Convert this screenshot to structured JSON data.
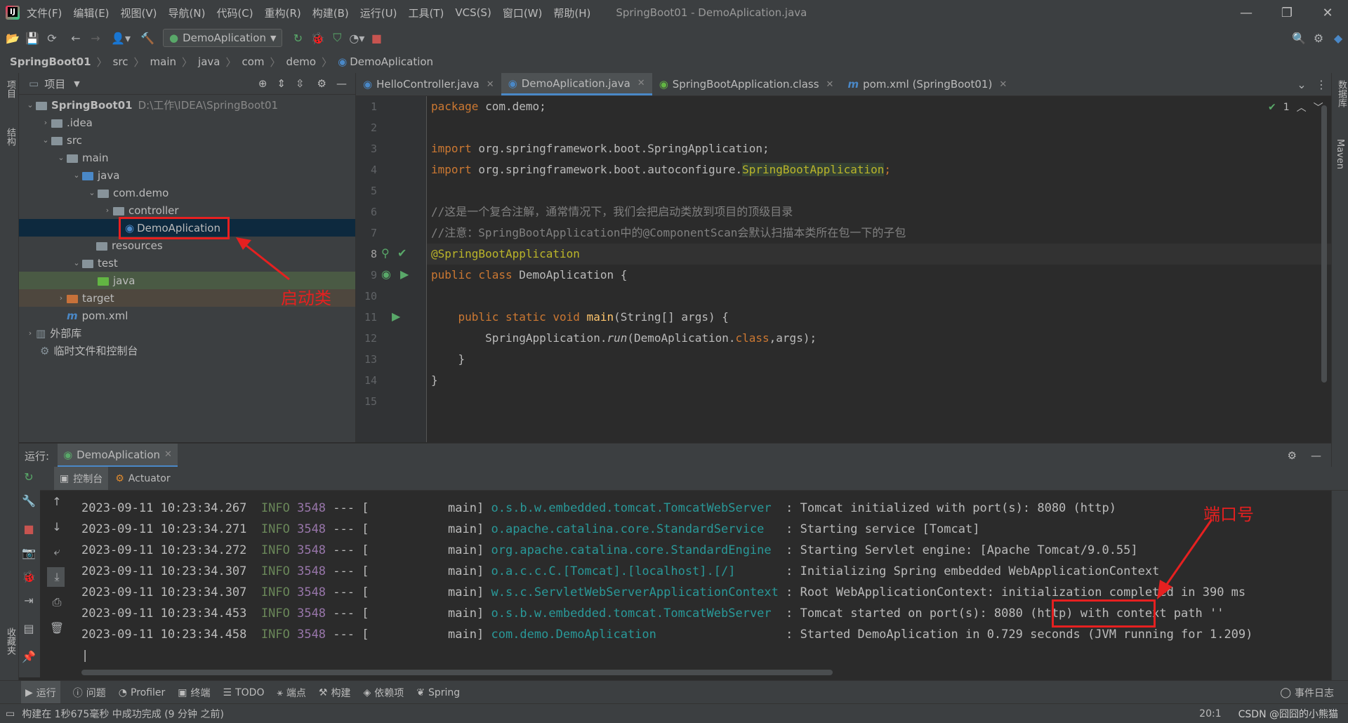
{
  "window": {
    "title": "SpringBoot01 - DemoAplication.java",
    "menu": [
      "文件(F)",
      "编辑(E)",
      "视图(V)",
      "导航(N)",
      "代码(C)",
      "重构(R)",
      "构建(B)",
      "运行(U)",
      "工具(T)",
      "VCS(S)",
      "窗口(W)",
      "帮助(H)"
    ]
  },
  "toolbar": {
    "run_config": "DemoAplication"
  },
  "breadcrumb": [
    "SpringBoot01",
    "src",
    "main",
    "java",
    "com",
    "demo",
    "DemoAplication"
  ],
  "left_stripe": {
    "project": "项目",
    "structure": "结构",
    "favorites": "收藏夹"
  },
  "right_stripe": {
    "database": "数据库",
    "maven": "Maven"
  },
  "project_panel": {
    "title": "项目",
    "tree": [
      {
        "label": "SpringBoot01",
        "path": "D:\\工作\\IDEA\\SpringBoot01"
      },
      {
        "label": ".idea"
      },
      {
        "label": "src"
      },
      {
        "label": "main"
      },
      {
        "label": "java"
      },
      {
        "label": "com.demo"
      },
      {
        "label": "controller"
      },
      {
        "label": "DemoAplication"
      },
      {
        "label": "resources"
      },
      {
        "label": "test"
      },
      {
        "label": "java"
      },
      {
        "label": "target"
      },
      {
        "label": "pom.xml"
      },
      {
        "label": "外部库"
      },
      {
        "label": "临时文件和控制台"
      }
    ]
  },
  "editor": {
    "tabs": [
      "HelloController.java",
      "DemoAplication.java",
      "SpringBootApplication.class",
      "pom.xml (SpringBoot01)"
    ],
    "inspection_count": "1",
    "line_numbers": [
      "1",
      "2",
      "3",
      "4",
      "5",
      "6",
      "7",
      "8",
      "9",
      "10",
      "11",
      "12",
      "13",
      "14",
      "15"
    ],
    "lines": {
      "l1_kw": "package",
      "l1_rest": " com.demo;",
      "l3_kw": "import",
      "l3_rest": " org.springframework.boot.SpringApplication;",
      "l4_kw": "import",
      "l4_mid": " org.springframework.boot.autoconfigure.",
      "l4_hl": "SpringBootApplication",
      "l4_end": ";",
      "l6": "//这是一个复合注解，通常情况下，我们会把启动类放到项目的顶级目录",
      "l7": "//注意：SpringBootApplication中的@ComponentScan会默认扫描本类所在包一下的子包",
      "l8": "@SpringBootApplication",
      "l9_kw": "public class",
      "l9_rest": " DemoAplication {",
      "l11_kw": "    public static void",
      "l11_fn": " main",
      "l11_rest": "(String[] args) {",
      "l12_a": "        SpringApplication.",
      "l12_it": "run",
      "l12_b": "(DemoAplication.",
      "l12_kw": "class",
      "l12_c": ",args);",
      "l13": "    }",
      "l14": "}"
    }
  },
  "run_panel": {
    "label": "运行:",
    "tab": "DemoAplication",
    "subtabs": [
      "控制台",
      "Actuator"
    ],
    "logs": [
      {
        "ts": "2023-09-11 10:23:34.267",
        "level": "INFO",
        "pid": "3548",
        "thread": "--- [           main]",
        "logger": "o.s.b.w.embedded.tomcat.TomcatWebServer ",
        "msg": " : Tomcat initialized with port(s): 8080 (http)"
      },
      {
        "ts": "2023-09-11 10:23:34.271",
        "level": "INFO",
        "pid": "3548",
        "thread": "--- [           main]",
        "logger": "o.apache.catalina.core.StandardService  ",
        "msg": " : Starting service [Tomcat]"
      },
      {
        "ts": "2023-09-11 10:23:34.272",
        "level": "INFO",
        "pid": "3548",
        "thread": "--- [           main]",
        "logger": "org.apache.catalina.core.StandardEngine ",
        "msg": " : Starting Servlet engine: [Apache Tomcat/9.0.55]"
      },
      {
        "ts": "2023-09-11 10:23:34.307",
        "level": "INFO",
        "pid": "3548",
        "thread": "--- [           main]",
        "logger": "o.a.c.c.C.[Tomcat].[localhost].[/]      ",
        "msg": " : Initializing Spring embedded WebApplicationContext"
      },
      {
        "ts": "2023-09-11 10:23:34.307",
        "level": "INFO",
        "pid": "3548",
        "thread": "--- [           main]",
        "logger": "w.s.c.ServletWebServerApplicationContext",
        "msg": " : Root WebApplicationContext: initialization completed in 390 ms"
      },
      {
        "ts": "2023-09-11 10:23:34.453",
        "level": "INFO",
        "pid": "3548",
        "thread": "--- [           main]",
        "logger": "o.s.b.w.embedded.tomcat.TomcatWebServer ",
        "msg": " : Tomcat started on port(s): 8080 (http) with context path ''"
      },
      {
        "ts": "2023-09-11 10:23:34.458",
        "level": "INFO",
        "pid": "3548",
        "thread": "--- [           main]",
        "logger": "com.demo.DemoAplication                 ",
        "msg": " : Started DemoAplication in 0.729 seconds (JVM running for 1.209)"
      }
    ]
  },
  "annotations": {
    "startup_class": "启动类",
    "port": "端口号"
  },
  "bottom_tabs": [
    "运行",
    "问题",
    "Profiler",
    "终端",
    "TODO",
    "端点",
    "构建",
    "依赖项",
    "Spring"
  ],
  "event_log": "事件日志",
  "status": {
    "message": "构建在 1秒675毫秒 中成功完成 (9 分钟 之前)",
    "position": "20:1",
    "watermark": "CSDN @囧囧的小熊猫"
  },
  "colors": {
    "accent": "#4a88c7",
    "highlight_red": "#e62020"
  }
}
